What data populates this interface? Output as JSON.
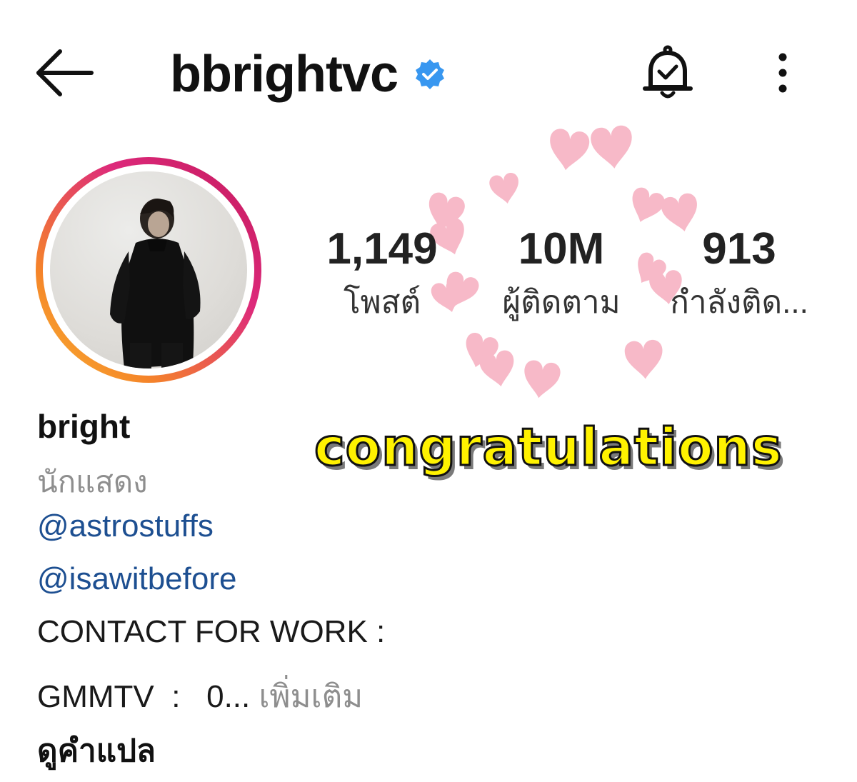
{
  "header": {
    "username": "bbrightvc",
    "verified": true,
    "icons": [
      "back-arrow-icon",
      "verified-badge-icon",
      "bell-icon",
      "more-vertical-icon"
    ]
  },
  "stats": {
    "posts": {
      "value": "1,149",
      "label": "โพสต์"
    },
    "followers": {
      "value": "10M",
      "label": "ผู้ติดตาม"
    },
    "following": {
      "value": "913",
      "label": "กำลังติด..."
    }
  },
  "profile": {
    "name": "bright",
    "category": "นักแสดง",
    "links": [
      "@astrostuffs",
      "@isawitbefore"
    ],
    "bio_line1": "CONTACT FOR WORK :",
    "bio_line2": "GMMTV  :   0...",
    "more_label": "เพิ่มเติม",
    "translate_label": "ดูคำแปล"
  },
  "sticker": {
    "text": "congratulations"
  },
  "colors": {
    "accent_link": "#1d4f91",
    "verified_blue": "#3897f0",
    "sticker_yellow": "#fff200",
    "heart_pink": "#f7b6c6"
  }
}
